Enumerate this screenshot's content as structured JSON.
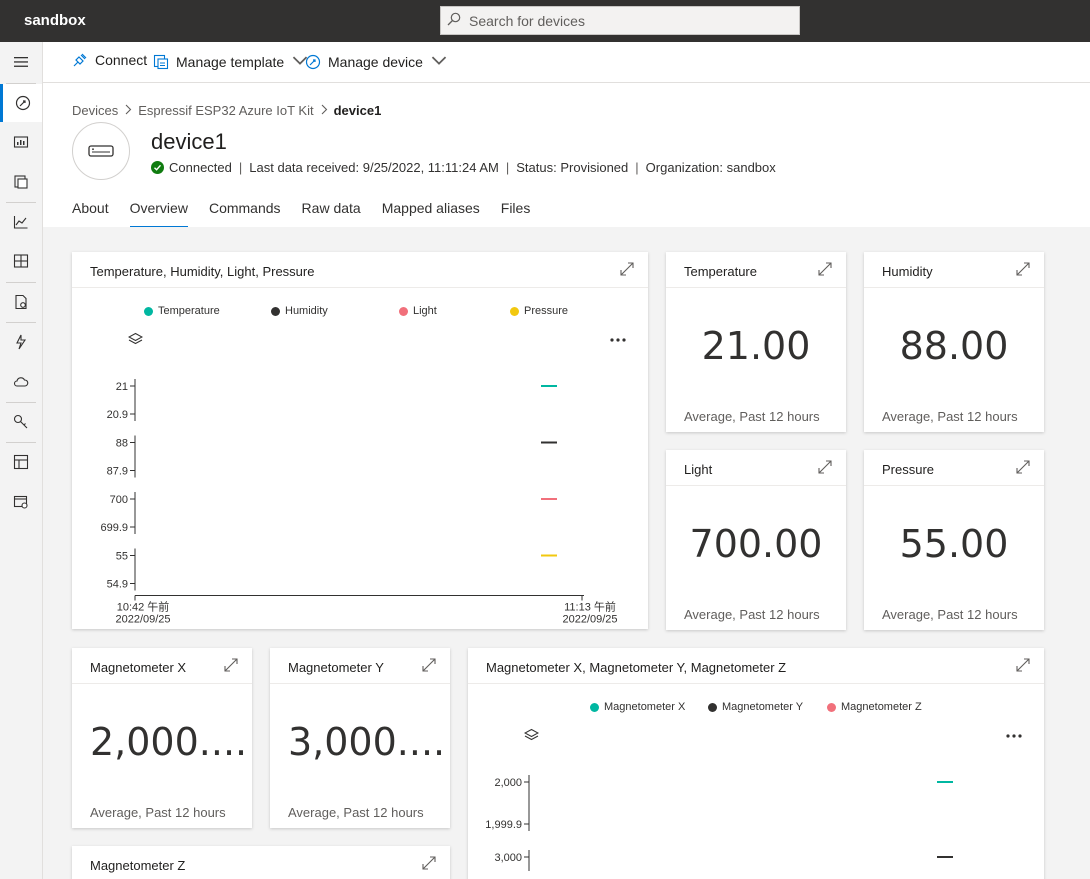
{
  "app": {
    "brand": "sandbox",
    "search_placeholder": "Search for devices"
  },
  "commands": {
    "connect": "Connect",
    "manage_template": "Manage template",
    "manage_device": "Manage device"
  },
  "breadcrumb": {
    "devices": "Devices",
    "template": "Espressif ESP32 Azure IoT Kit",
    "current": "device1"
  },
  "device": {
    "name": "device1",
    "status_connected": "Connected",
    "last_data": "Last data received: 9/25/2022, 11:11:24 AM",
    "provision": "Status: Provisioned",
    "organization": "Organization: sandbox"
  },
  "tabs": [
    "About",
    "Overview",
    "Commands",
    "Raw data",
    "Mapped aliases",
    "Files"
  ],
  "colors": {
    "temperature": "#00b7a1",
    "humidity": "#323130",
    "light": "#f1707b",
    "pressure": "#f2c80f",
    "accent": "#0078d4"
  },
  "tiles": {
    "chart1_title": "Temperature, Humidity, Light, Pressure",
    "temperature": {
      "title": "Temperature",
      "value": "21.00",
      "sub": "Average, Past 12 hours"
    },
    "humidity": {
      "title": "Humidity",
      "value": "88.00",
      "sub": "Average, Past 12 hours"
    },
    "light": {
      "title": "Light",
      "value": "700.00",
      "sub": "Average, Past 12 hours"
    },
    "pressure": {
      "title": "Pressure",
      "value": "55.00",
      "sub": "Average, Past 12 hours"
    },
    "mag_x": {
      "title": "Magnetometer X",
      "value": "2,000....",
      "sub": "Average, Past 12 hours"
    },
    "mag_y": {
      "title": "Magnetometer Y",
      "value": "3,000....",
      "sub": "Average, Past 12 hours"
    },
    "mag_z": {
      "title": "Magnetometer Z"
    },
    "chart2_title": "Magnetometer X, Magnetometer Y, Magnetometer Z"
  },
  "chart_data": [
    {
      "type": "line",
      "title": "Temperature, Humidity, Light, Pressure",
      "legend": [
        "Temperature",
        "Humidity",
        "Light",
        "Pressure"
      ],
      "x_ticks": [
        {
          "time": "10:42 午前",
          "date": "2022/09/25"
        },
        {
          "time": "11:13 午前",
          "date": "2022/09/25"
        }
      ],
      "series": [
        {
          "name": "Temperature",
          "y_ticks": [
            "21",
            "20.9"
          ],
          "value": 21,
          "ylim": [
            20.9,
            21
          ]
        },
        {
          "name": "Humidity",
          "y_ticks": [
            "88",
            "87.9"
          ],
          "value": 88,
          "ylim": [
            87.9,
            88
          ]
        },
        {
          "name": "Light",
          "y_ticks": [
            "700",
            "699.9"
          ],
          "value": 700,
          "ylim": [
            699.9,
            700
          ]
        },
        {
          "name": "Pressure",
          "y_ticks": [
            "55",
            "54.9"
          ],
          "value": 55,
          "ylim": [
            54.9,
            55
          ]
        }
      ],
      "legend_position": "top"
    },
    {
      "type": "line",
      "title": "Magnetometer X, Magnetometer Y, Magnetometer Z",
      "legend": [
        "Magnetometer X",
        "Magnetometer Y",
        "Magnetometer Z"
      ],
      "series": [
        {
          "name": "Magnetometer X",
          "y_ticks": [
            "2,000",
            "1,999.9"
          ],
          "value": 2000,
          "ylim": [
            1999.9,
            2000
          ]
        },
        {
          "name": "Magnetometer Y",
          "y_ticks": [
            "3,000"
          ],
          "value": 3000
        }
      ],
      "legend_position": "top"
    }
  ]
}
